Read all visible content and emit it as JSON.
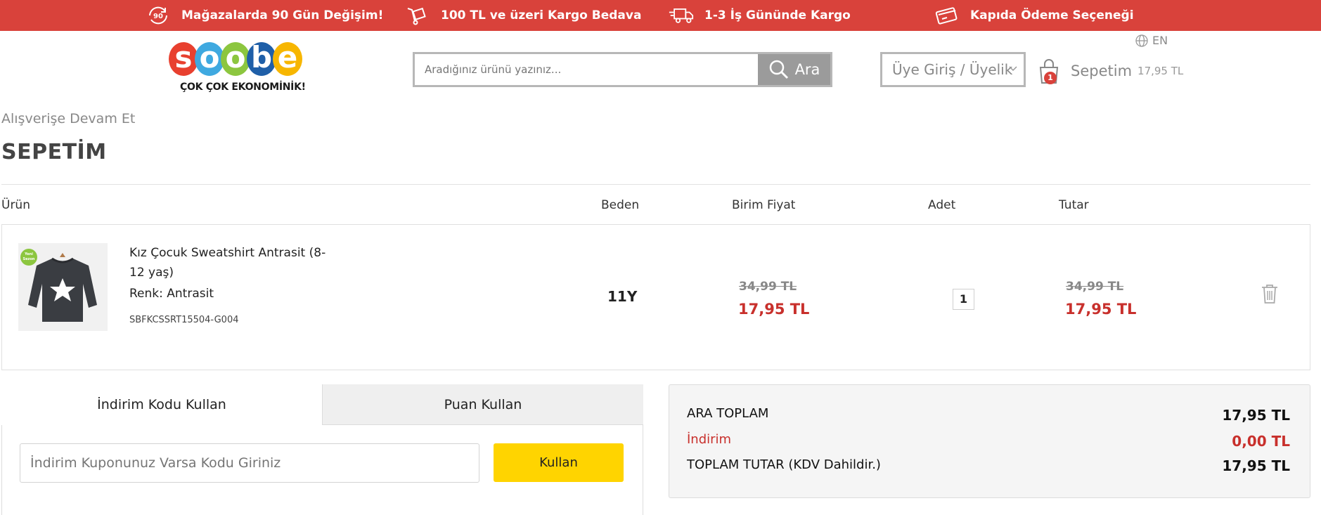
{
  "promo_bar": {
    "items": [
      {
        "icon": "90-days-exchange-icon",
        "label": "Mağazalarda 90 Gün Değişim!"
      },
      {
        "icon": "cargo-trolley-icon",
        "label": "100 TL ve üzeri Kargo Bedava"
      },
      {
        "icon": "delivery-truck-icon",
        "label": "1-3 İş Gününde Kargo"
      },
      {
        "icon": "payment-card-icon",
        "label": "Kapıda Ödeme Seçeneği"
      }
    ]
  },
  "header": {
    "logo_letters": [
      "s",
      "o",
      "o",
      "b",
      "e"
    ],
    "logo_colors": [
      "#e8402f",
      "#3fa9e0",
      "#8cc63f",
      "#1f5fa8",
      "#f7b600"
    ],
    "logo_tagline": "ÇOK ÇOK EKONOMİNİK!",
    "search_placeholder": "Aradığınız ürünü yazınız...",
    "search_button": "Ara",
    "language": "EN",
    "login_label": "Üye Giriş / Üyelik",
    "cart_label": "Sepetim",
    "cart_amount": "17,95 TL",
    "cart_count": "1"
  },
  "page": {
    "continue_link": "Alışverişe Devam Et",
    "title": "SEPETİM"
  },
  "table": {
    "headers": {
      "product": "Ürün",
      "size": "Beden",
      "unit_price": "Birim Fiyat",
      "quantity": "Adet",
      "total": "Tutar"
    },
    "items": [
      {
        "image_badge": "Yeni Sezon",
        "name": "Kız Çocuk Sweatshirt Antrasit (8-12 yaş)",
        "color": "Renk: Antrasit",
        "sku": "SBFKCSSRT15504-G004",
        "size": "11Y",
        "unit_old_price": "34,99 TL",
        "unit_price": "17,95 TL",
        "quantity": "1",
        "total_old_price": "34,99 TL",
        "total_price": "17,95 TL"
      }
    ]
  },
  "coupon": {
    "tab_discount": "İndirim Kodu Kullan",
    "tab_points": "Puan Kullan",
    "input_placeholder": "İndirim Kuponunuz Varsa Kodu Giriniz",
    "apply_button": "Kullan"
  },
  "summary": {
    "subtotal_label": "ARA TOPLAM",
    "subtotal_value": "17,95 TL",
    "discount_label": "İndirim",
    "discount_value": "0,00 TL",
    "total_label": "TOPLAM TUTAR (KDV Dahildir.)",
    "total_value": "17,95 TL"
  },
  "colors": {
    "promo_bar": "#d9423b",
    "price_red": "#c8302c",
    "apply_button": "#ffd400"
  }
}
